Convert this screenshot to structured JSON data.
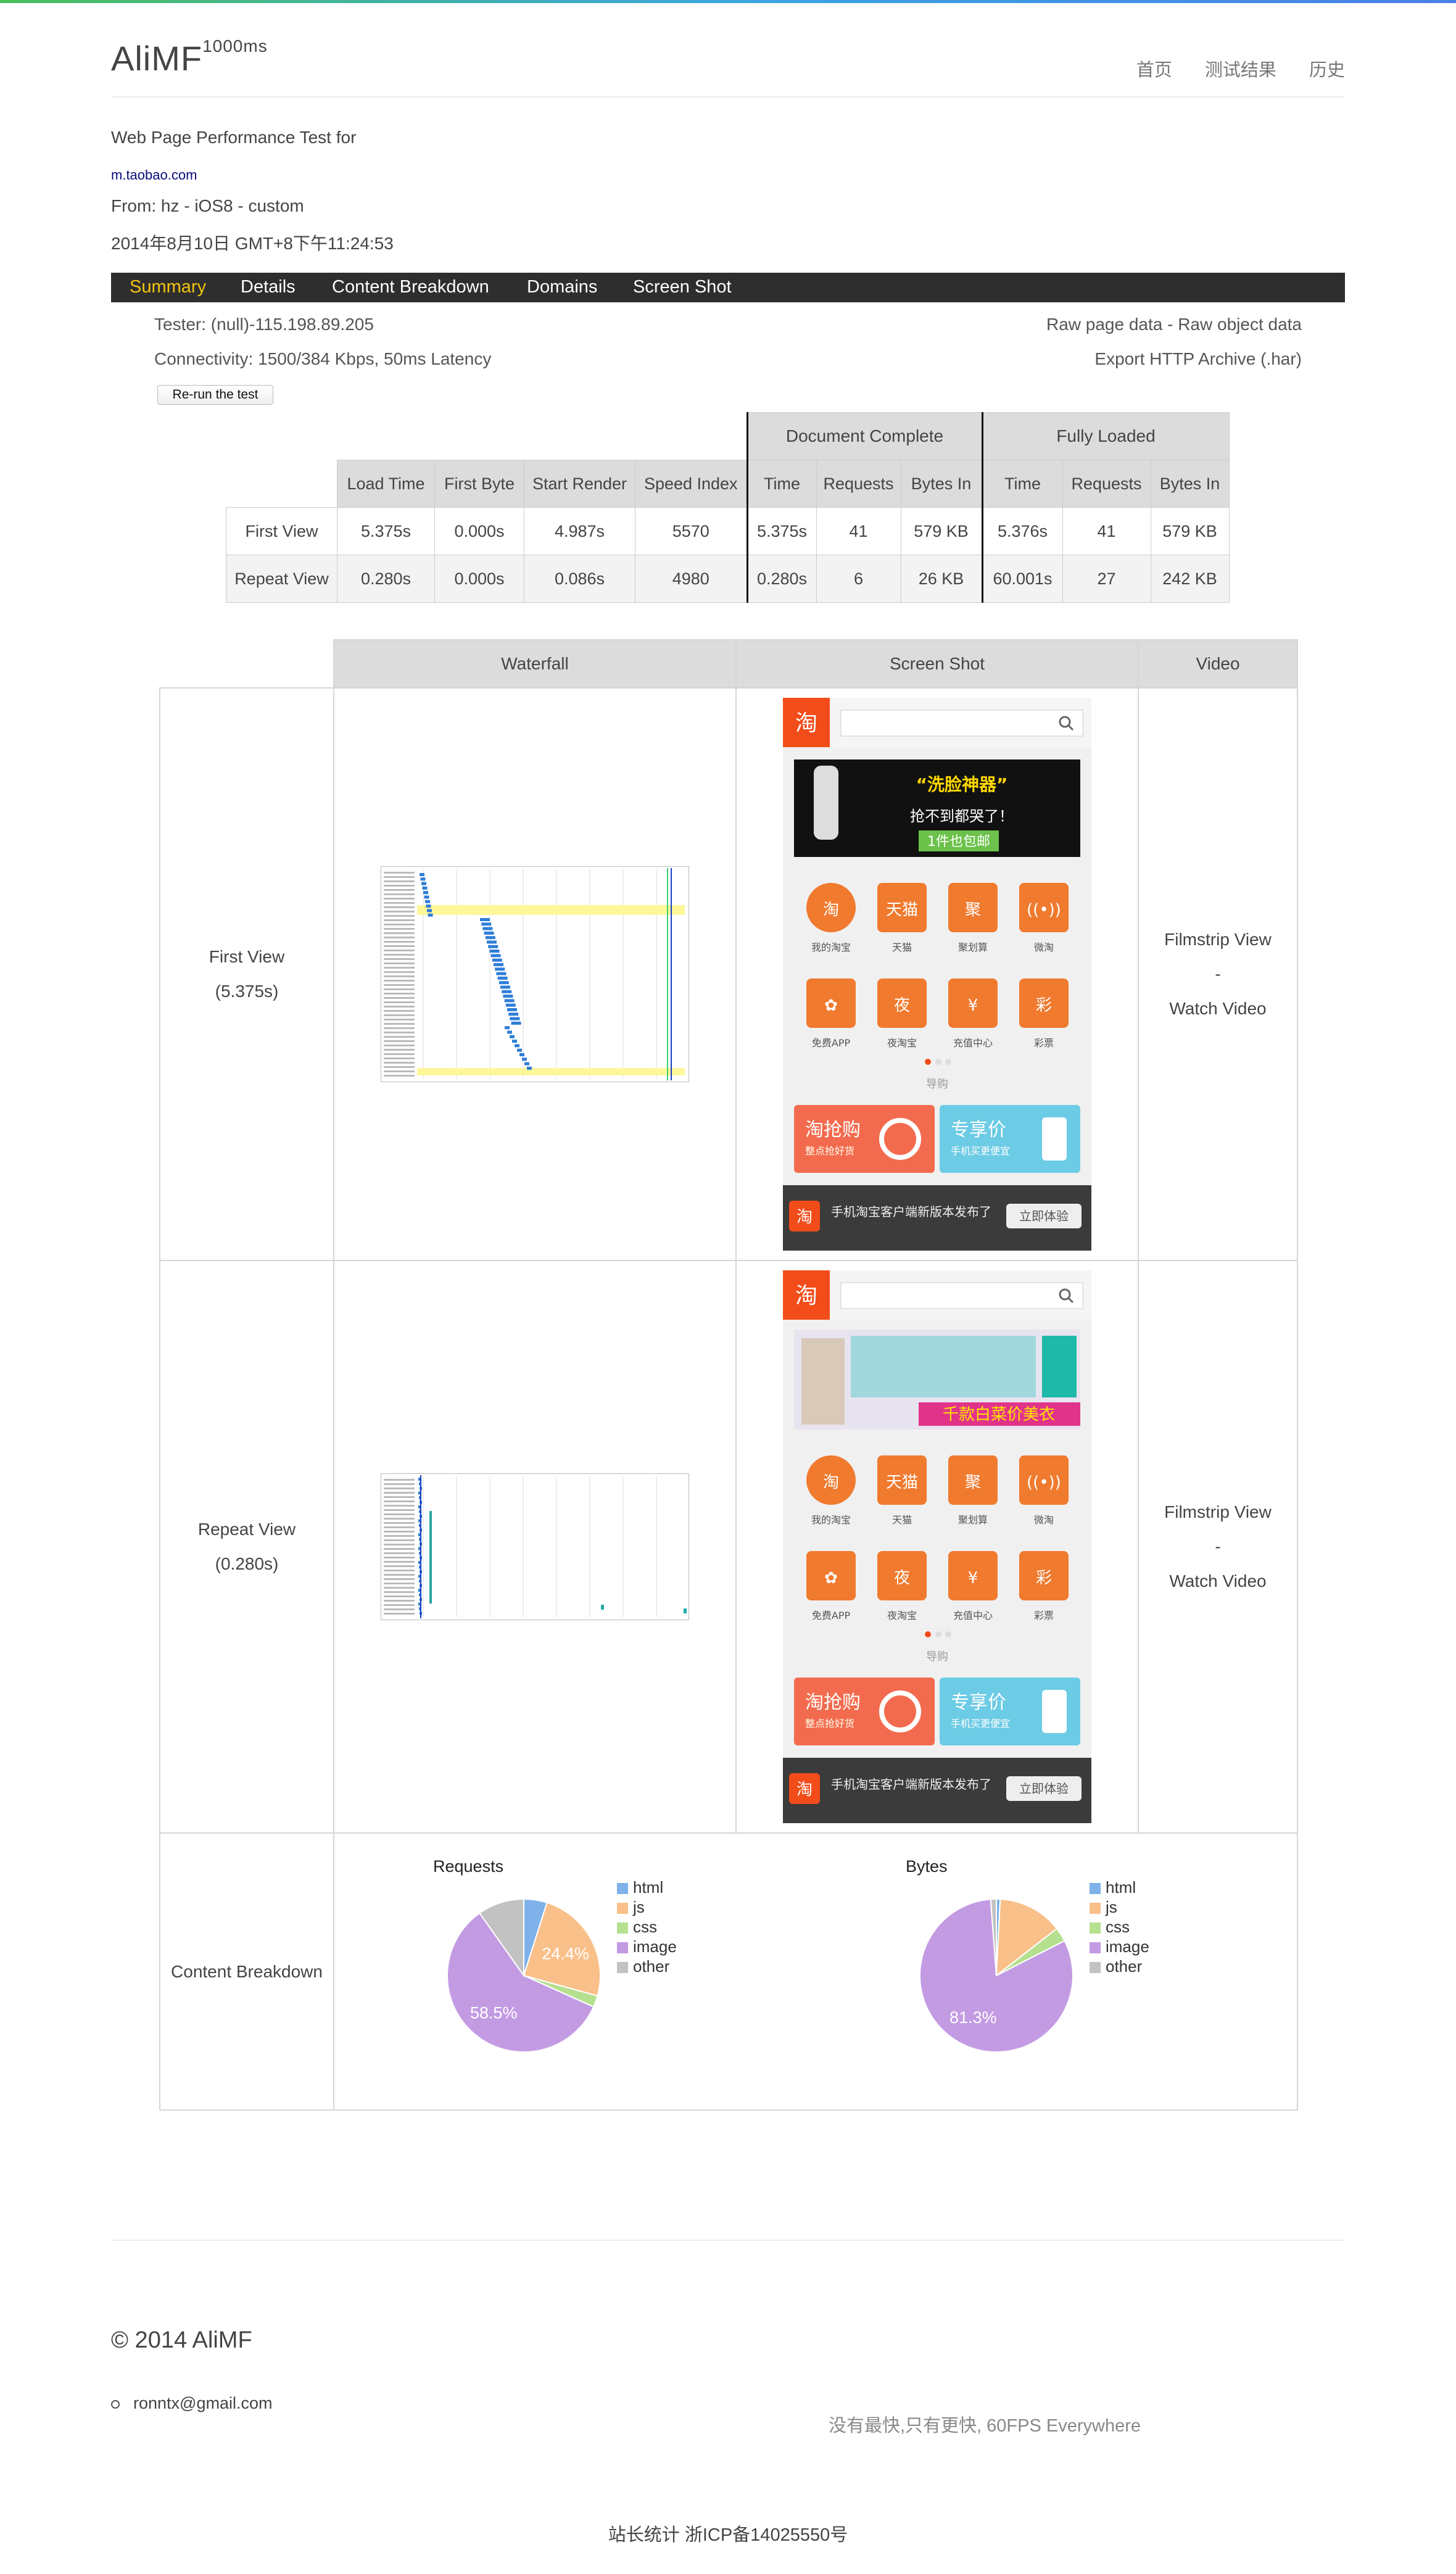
{
  "header": {
    "logo": "AliMF",
    "logo_sup": "1000ms",
    "nav": [
      "首页",
      "测试结果",
      "历史"
    ]
  },
  "test_info": {
    "title": "Web Page Performance Test for",
    "url": "m.taobao.com",
    "from": "From: hz - iOS8 - custom",
    "date": "2014年8月10日 GMT+8下午11:24:53"
  },
  "tabs": [
    "Summary",
    "Details",
    "Content Breakdown",
    "Domains",
    "Screen Shot"
  ],
  "meta": {
    "tester": "Tester: (null)-115.198.89.205",
    "connectivity": "Connectivity: 1500/384 Kbps, 50ms Latency",
    "raw": "Raw page data - Raw object data",
    "har": "Export HTTP Archive (.har)",
    "rerun": "Re-run the test"
  },
  "perf_table": {
    "group_doc": "Document Complete",
    "group_full": "Fully Loaded",
    "headers": [
      "Load Time",
      "First Byte",
      "Start Render",
      "Speed Index",
      "Time",
      "Requests",
      "Bytes In",
      "Time",
      "Requests",
      "Bytes In"
    ],
    "rows": [
      {
        "label": "First View",
        "cells": [
          "5.375s",
          "0.000s",
          "4.987s",
          "5570",
          "5.375s",
          "41",
          "579 KB",
          "5.376s",
          "41",
          "579 KB"
        ]
      },
      {
        "label": "Repeat View",
        "cells": [
          "0.280s",
          "0.000s",
          "0.086s",
          "4980",
          "0.280s",
          "6",
          "26 KB",
          "60.001s",
          "27",
          "242 KB"
        ]
      }
    ]
  },
  "views_table": {
    "headers": [
      "Waterfall",
      "Screen Shot",
      "Video"
    ],
    "first": {
      "label": "First View",
      "time": "(5.375s)"
    },
    "repeat": {
      "label": "Repeat View",
      "time": "(0.280s)"
    },
    "video_links": {
      "filmstrip": "Filmstrip View",
      "sep": "-",
      "watch": "Watch Video"
    },
    "content_label": "Content Breakdown"
  },
  "phone": {
    "logo_char": "淘",
    "first_banner": "“洗脸神器”",
    "first_banner_sub1": "抢不到都哭了！",
    "first_banner_sub2": "1件也包邮",
    "repeat_banner": "千款白菜价美衣",
    "icons_row1": [
      "我的淘宝",
      "天猫",
      "聚划算",
      "微淘"
    ],
    "icons_row1_glyphs": [
      "淘",
      "天猫",
      "聚",
      "((•))"
    ],
    "icons_row2": [
      "免费APP",
      "夜淘宝",
      "充值中心",
      "彩票"
    ],
    "icons_row2_glyphs": [
      "✿",
      "夜",
      "¥",
      "彩"
    ],
    "guide": "导购",
    "promo1": "淘抢购",
    "promo1_sub": "整点抢好货",
    "promo2": "专享价",
    "promo2_sub": "手机买更便宜",
    "bottom_msg": "手机淘宝客户端新版本发布了",
    "bottom_btn": "立即体验"
  },
  "chart_data": [
    {
      "type": "pie",
      "title": "Requests",
      "categories": [
        "html",
        "js",
        "css",
        "image",
        "other"
      ],
      "values": [
        4.9,
        24.4,
        2.4,
        58.5,
        9.8
      ],
      "colors": [
        "#7fb2ea",
        "#f9c08a",
        "#b5e08f",
        "#c39be3",
        "#c2c2c2"
      ],
      "labels_shown": [
        "24.4%",
        "58.5%"
      ],
      "legend": "right"
    },
    {
      "type": "pie",
      "title": "Bytes",
      "categories": [
        "html",
        "js",
        "css",
        "image",
        "other"
      ],
      "values": [
        0.8,
        13.7,
        3.0,
        81.3,
        1.2
      ],
      "colors": [
        "#7fb2ea",
        "#f9c08a",
        "#b5e08f",
        "#c39be3",
        "#c2c2c2"
      ],
      "labels_shown": [
        "81.3%"
      ],
      "legend": "right"
    }
  ],
  "footer": {
    "copyright": "© 2014 AliMF",
    "email": "ronntx@gmail.com",
    "slogan": "没有最快,只有更快, 60FPS Everywhere",
    "icp": "站长统计 浙ICP备14025550号"
  }
}
